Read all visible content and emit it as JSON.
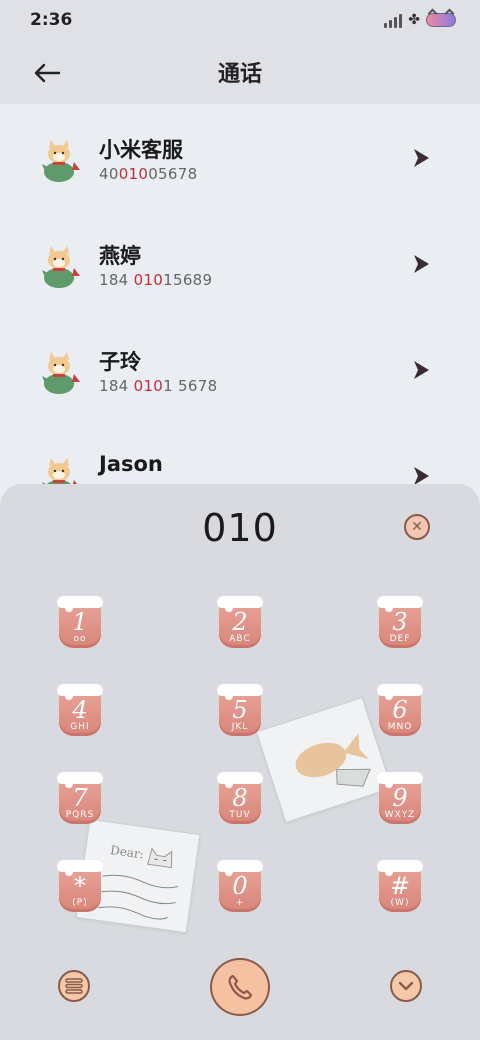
{
  "status_bar": {
    "time": "2:36",
    "icons": [
      "signal-icon",
      "clover-icon",
      "battery-icon"
    ]
  },
  "header": {
    "title": "通话",
    "back_icon": "back-arrow-icon"
  },
  "contacts": [
    {
      "name": "小米客服",
      "number_pre": "40",
      "number_hl": "010",
      "number_post": "05678"
    },
    {
      "name": "燕婷",
      "number_pre": "184 ",
      "number_hl": "010",
      "number_post": "15689"
    },
    {
      "name": "子玲",
      "number_pre": "184 ",
      "number_hl": "010",
      "number_post": "1 5678"
    },
    {
      "name": "Jason",
      "number_pre": "",
      "number_hl": "",
      "number_post": ""
    }
  ],
  "dialer": {
    "input_value": "010",
    "keys": [
      {
        "digit": "1",
        "letters": "oo"
      },
      {
        "digit": "2",
        "letters": "ABC"
      },
      {
        "digit": "3",
        "letters": "DEF"
      },
      {
        "digit": "4",
        "letters": "GHI"
      },
      {
        "digit": "5",
        "letters": "JKL"
      },
      {
        "digit": "6",
        "letters": "MNO"
      },
      {
        "digit": "7",
        "letters": "PQRS"
      },
      {
        "digit": "8",
        "letters": "TUV"
      },
      {
        "digit": "9",
        "letters": "WXYZ"
      },
      {
        "digit": "*",
        "letters": "(P)"
      },
      {
        "digit": "0",
        "letters": "+"
      },
      {
        "digit": "#",
        "letters": "(W)"
      }
    ],
    "card_text": "Dear:"
  },
  "colors": {
    "accent": "#c0303a",
    "key_fill": "#d9857a",
    "button_fill": "#f3c9aa",
    "button_border": "#8a5a4a"
  }
}
